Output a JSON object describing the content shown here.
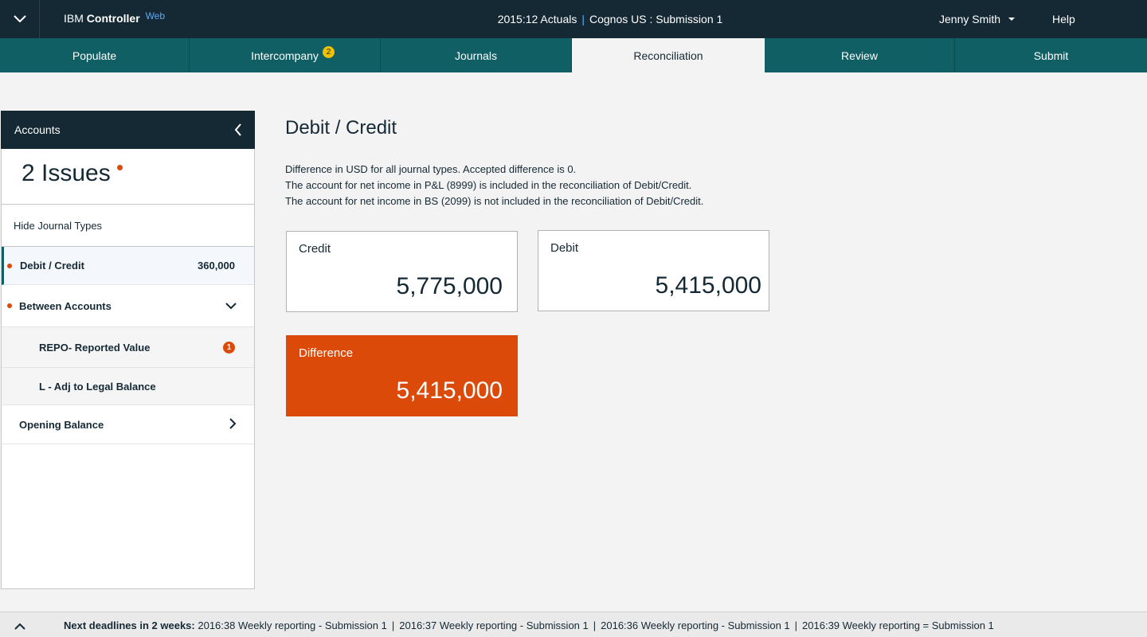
{
  "topbar": {
    "brand_ibm": "IBM",
    "brand_product": "Controller",
    "brand_web": "Web",
    "period": "2015:12 Actuals",
    "submission": "Cognos US : Submission 1",
    "user": "Jenny Smith",
    "help": "Help"
  },
  "tabs": [
    {
      "label": "Populate",
      "badge": ""
    },
    {
      "label": "Intercompany",
      "badge": "2"
    },
    {
      "label": "Journals",
      "badge": ""
    },
    {
      "label": "Reconciliation",
      "badge": "",
      "active": true
    },
    {
      "label": "Review",
      "badge": ""
    },
    {
      "label": "Submit",
      "badge": ""
    }
  ],
  "sidebar": {
    "title": "Accounts",
    "issues": "2 Issues",
    "hide_types": "Hide Journal Types",
    "items": [
      {
        "label": "Debit / Credit",
        "value": "360,000"
      },
      {
        "label": "Between Accounts"
      },
      {
        "label": "REPO- Reported Value",
        "count": "1"
      },
      {
        "label": "L - Adj to Legal Balance"
      },
      {
        "label": "Opening Balance"
      }
    ]
  },
  "main": {
    "title": "Debit / Credit",
    "desc": [
      "Difference in USD for all journal types. Accepted difference is 0.",
      "The account for net income in P&L (8999) is included in the reconciliation of Debit/Credit.",
      "The account for net income in BS (2099) is not included in the reconciliation of Debit/Credit."
    ],
    "cards": {
      "credit": {
        "label": "Credit",
        "amount": "5,775,000"
      },
      "debit": {
        "label": "Debit",
        "amount": "5,415,000"
      },
      "difference": {
        "label": "Difference",
        "amount": "5,415,000"
      }
    }
  },
  "footer": {
    "prefix": "Next deadlines in 2 weeks:",
    "items": [
      "2016:38 Weekly reporting - Submission 1",
      "2016:37 Weekly reporting - Submission 1",
      "2016:36 Weekly reporting - Submission 1",
      "2016:39 Weekly reporting = Submission 1"
    ]
  },
  "colors": {
    "header": "#152935",
    "tabs": "#0f5f65",
    "alert": "#dc4a0a",
    "badge": "#efc100",
    "brand_accent": "#5aaafa"
  }
}
